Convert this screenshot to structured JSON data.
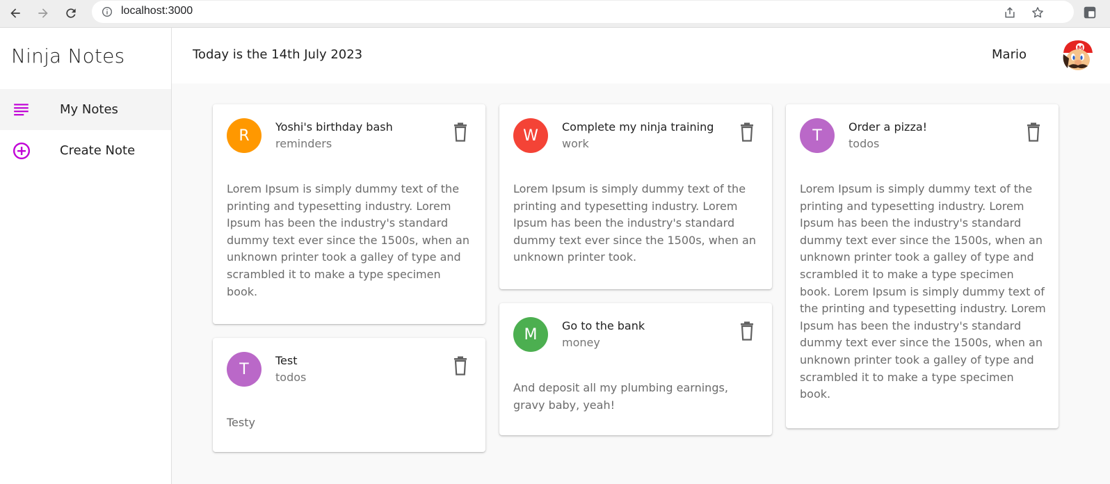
{
  "browser": {
    "url": "localhost:3000",
    "icons": [
      "back-icon",
      "forward-icon",
      "reload-icon",
      "info-icon",
      "share-icon",
      "star-icon",
      "extension-icon"
    ]
  },
  "sidebar": {
    "brand": "Ninja Notes",
    "items": [
      {
        "label": "My Notes",
        "icon": "notes-list-icon",
        "active": true
      },
      {
        "label": "Create Note",
        "icon": "add-circle-icon",
        "active": false
      }
    ]
  },
  "header": {
    "date": "Today is the 14th July 2023",
    "user": "Mario"
  },
  "colors": {
    "accent": "#c000d6",
    "orange": "#ff9800",
    "red": "#f44336",
    "purple": "#ba68c8",
    "green": "#4caf50"
  },
  "notes": [
    {
      "initial": "R",
      "title": "Yoshi's birthday bash",
      "category": "reminders",
      "body": "Lorem Ipsum is simply dummy text of the printing and typesetting industry. Lorem Ipsum has been the industry's standard dummy text ever since the 1500s, when an unknown printer took a galley of type and scrambled it to make a type specimen book."
    },
    {
      "initial": "W",
      "title": "Complete my ninja training",
      "category": "work",
      "body": "Lorem Ipsum is simply dummy text of the printing and typesetting industry. Lorem Ipsum has been the industry's standard dummy text ever since the 1500s, when an unknown printer took."
    },
    {
      "initial": "T",
      "title": "Order a pizza!",
      "category": "todos",
      "body": "Lorem Ipsum is simply dummy text of the printing and typesetting industry. Lorem Ipsum has been the industry's standard dummy text ever since the 1500s, when an unknown printer took a galley of type and scrambled it to make a type specimen book. Lorem Ipsum is simply dummy text of the printing and typesetting industry. Lorem Ipsum has been the industry's standard dummy text ever since the 1500s, when an unknown printer took a galley of type and scrambled it to make a type specimen book."
    },
    {
      "initial": "T",
      "title": "Test",
      "category": "todos",
      "body": "Testy"
    },
    {
      "initial": "M",
      "title": "Go to the bank",
      "category": "money",
      "body": "And deposit all my plumbing earnings, gravy baby, yeah!"
    }
  ]
}
